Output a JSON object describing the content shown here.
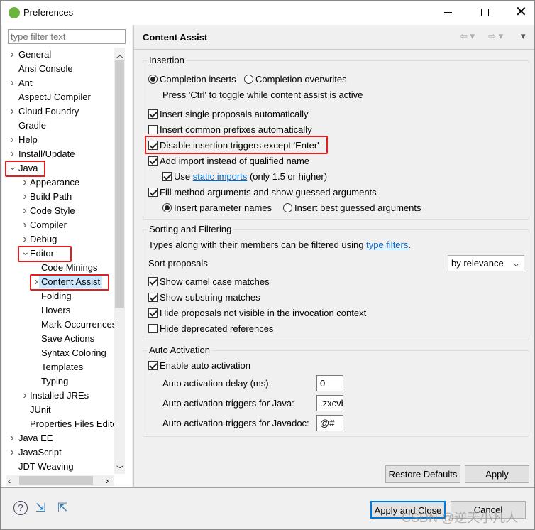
{
  "window": {
    "title": "Preferences"
  },
  "filter": {
    "placeholder": "type filter text"
  },
  "tree": [
    {
      "label": "General",
      "level": 0,
      "chevron": ">"
    },
    {
      "label": "Ansi Console",
      "level": 0,
      "chevron": ""
    },
    {
      "label": "Ant",
      "level": 0,
      "chevron": ">"
    },
    {
      "label": "AspectJ Compiler",
      "level": 0,
      "chevron": ""
    },
    {
      "label": "Cloud Foundry",
      "level": 0,
      "chevron": ">"
    },
    {
      "label": "Gradle",
      "level": 0,
      "chevron": ""
    },
    {
      "label": "Help",
      "level": 0,
      "chevron": ">"
    },
    {
      "label": "Install/Update",
      "level": 0,
      "chevron": ">"
    },
    {
      "label": "Java",
      "level": 0,
      "chevron": "v",
      "highlight": true
    },
    {
      "label": "Appearance",
      "level": 1,
      "chevron": ">"
    },
    {
      "label": "Build Path",
      "level": 1,
      "chevron": ">"
    },
    {
      "label": "Code Style",
      "level": 1,
      "chevron": ">"
    },
    {
      "label": "Compiler",
      "level": 1,
      "chevron": ">"
    },
    {
      "label": "Debug",
      "level": 1,
      "chevron": ">"
    },
    {
      "label": "Editor",
      "level": 1,
      "chevron": "v",
      "highlight": true
    },
    {
      "label": "Code Minings",
      "level": 2,
      "chevron": ""
    },
    {
      "label": "Content Assist",
      "level": 2,
      "chevron": ">",
      "selected": true,
      "highlight": true
    },
    {
      "label": "Folding",
      "level": 2,
      "chevron": ""
    },
    {
      "label": "Hovers",
      "level": 2,
      "chevron": ""
    },
    {
      "label": "Mark Occurrences",
      "level": 2,
      "chevron": ""
    },
    {
      "label": "Save Actions",
      "level": 2,
      "chevron": ""
    },
    {
      "label": "Syntax Coloring",
      "level": 2,
      "chevron": ""
    },
    {
      "label": "Templates",
      "level": 2,
      "chevron": ""
    },
    {
      "label": "Typing",
      "level": 2,
      "chevron": ""
    },
    {
      "label": "Installed JREs",
      "level": 1,
      "chevron": ">"
    },
    {
      "label": "JUnit",
      "level": 1,
      "chevron": ""
    },
    {
      "label": "Properties Files Editor",
      "level": 1,
      "chevron": ""
    },
    {
      "label": "Java EE",
      "level": 0,
      "chevron": ">"
    },
    {
      "label": "JavaScript",
      "level": 0,
      "chevron": ">"
    },
    {
      "label": "JDT Weaving",
      "level": 0,
      "chevron": ""
    }
  ],
  "page": {
    "title": "Content Assist"
  },
  "insertion": {
    "title": "Insertion",
    "radio_inserts": "Completion inserts",
    "radio_overwrites": "Completion overwrites",
    "hint": "Press 'Ctrl' to toggle while content assist is active",
    "single_proposals": "Insert single proposals automatically",
    "common_prefixes": "Insert common prefixes automatically",
    "disable_triggers": "Disable insertion triggers except 'Enter'",
    "add_import": "Add import instead of qualified name",
    "use_label": "Use",
    "static_imports": "static imports",
    "static_suffix": "(only 1.5 or higher)",
    "fill_args": "Fill method arguments and show guessed arguments",
    "param_names": "Insert parameter names",
    "guessed_args": "Insert best guessed arguments"
  },
  "sorting": {
    "title": "Sorting and Filtering",
    "desc": "Types along with their members can be filtered using",
    "type_filters": "type filters",
    "desc_end": ".",
    "sort_label": "Sort proposals",
    "sort_value": "by relevance",
    "camel": "Show camel case matches",
    "substring": "Show substring matches",
    "hide_invisible": "Hide proposals not visible in the invocation context",
    "hide_deprecated": "Hide deprecated references"
  },
  "auto": {
    "title": "Auto Activation",
    "enable": "Enable auto activation",
    "delay_label": "Auto activation delay (ms):",
    "delay_value": "0",
    "java_label": "Auto activation triggers for Java:",
    "java_value": ".zxcvbnm",
    "javadoc_label": "Auto activation triggers for Javadoc:",
    "javadoc_value": "@#"
  },
  "buttons": {
    "restore": "Restore Defaults",
    "apply": "Apply",
    "apply_close": "Apply and Close",
    "cancel": "Cancel"
  },
  "watermark": "CSDN @逆天小凡人"
}
